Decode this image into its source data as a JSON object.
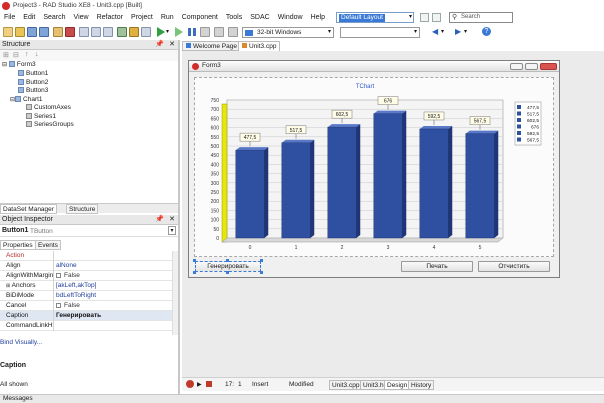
{
  "window_title": "Project3 - RAD Studio XE8 - Unit3.cpp [Built]",
  "menu": [
    "File",
    "Edit",
    "Search",
    "View",
    "Refactor",
    "Project",
    "Run",
    "Component",
    "Tools",
    "SDAC",
    "Window",
    "Help"
  ],
  "layout_select": "Default Layout",
  "search_placeholder": "Search",
  "platform_select": "32-bit Windows",
  "structure": {
    "title": "Structure",
    "tree": [
      "Form3",
      "Button1",
      "Button2",
      "Button3",
      "Chart1",
      "CustomAxes",
      "Series1",
      "SeriesGroups"
    ]
  },
  "panel_tabs": [
    "DataSet Manager",
    "Structure"
  ],
  "object_inspector": {
    "title": "Object Inspector",
    "selected": "Button1",
    "selected_type": "TButton",
    "tabs": [
      "Properties",
      "Events"
    ],
    "rows": [
      {
        "name": "Action",
        "value": ""
      },
      {
        "name": "Align",
        "value": "alNone"
      },
      {
        "name": "AlignWithMargin",
        "value": "False"
      },
      {
        "name": "Anchors",
        "value": "[akLeft,akTop]"
      },
      {
        "name": "BiDiMode",
        "value": "bdLeftToRight"
      },
      {
        "name": "Cancel",
        "value": "False"
      },
      {
        "name": "Caption",
        "value": "Генерировать"
      },
      {
        "name": "CommandLinkHi",
        "value": ""
      }
    ],
    "bind_visually": "Bind Visually...",
    "caption_label": "Caption",
    "all_shown": "All shown"
  },
  "messages_label": "Messages",
  "doc_tabs": [
    "Welcome Page",
    "Unit3.cpp"
  ],
  "form": {
    "title": "Form3",
    "buttons": [
      "Генерировать",
      "Печать",
      "Отчистить"
    ]
  },
  "status": {
    "line": "17:",
    "col": "1",
    "mode": "Insert",
    "state": "Modified",
    "file_tabs": [
      "Unit3.cpp",
      "Unit3.h",
      "Design",
      "History"
    ]
  },
  "chart_data": {
    "type": "bar",
    "title": "TChart",
    "categories": [
      "0",
      "1",
      "2",
      "3",
      "4",
      "5"
    ],
    "values": [
      477.5,
      517.5,
      602.5,
      676,
      592.5,
      567.5
    ],
    "data_labels": [
      "477,5",
      "517,5",
      "602,5",
      "676",
      "592,5",
      "567,5"
    ],
    "legend": [
      "477,5",
      "517,5",
      "602,5",
      "676",
      "592,5",
      "567,5"
    ],
    "legend_placement": "right",
    "yticks": [
      "0",
      "50",
      "100",
      "150",
      "200",
      "250",
      "300",
      "350",
      "400",
      "450",
      "500",
      "550",
      "600",
      "650",
      "700",
      "750"
    ],
    "ylim": [
      0,
      750
    ],
    "grid": true,
    "bar_color": "#2f4fa0"
  }
}
